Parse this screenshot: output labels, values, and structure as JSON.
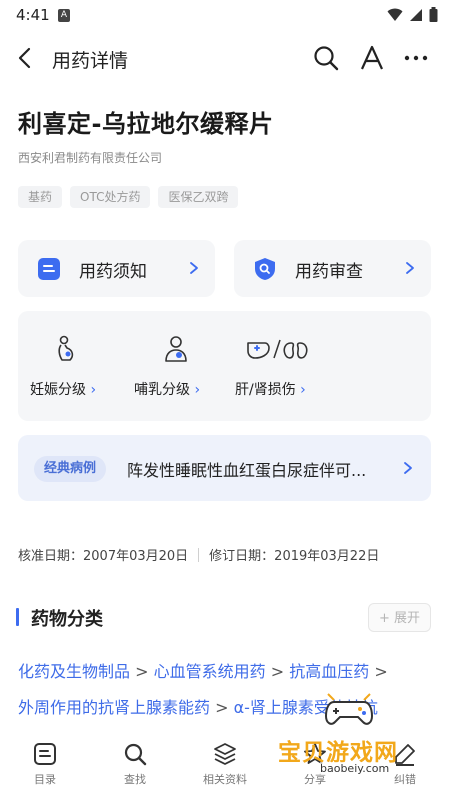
{
  "status_bar": {
    "time": "4:41",
    "badge": "A"
  },
  "header": {
    "title": "用药详情"
  },
  "drug": {
    "name": "利喜定-乌拉地尔缓释片",
    "company": "西安利君制药有限责任公司",
    "tags": [
      "基药",
      "OTC处方药",
      "医保乙双跨"
    ]
  },
  "quick_actions": [
    {
      "label": "用药须知",
      "icon": "document-icon"
    },
    {
      "label": "用药审查",
      "icon": "shield-search-icon"
    }
  ],
  "special_groups": [
    {
      "label": "妊娠分级",
      "icon": "pregnancy-icon"
    },
    {
      "label": "哺乳分级",
      "icon": "breastfeeding-icon"
    },
    {
      "label": "肝/肾损伤",
      "icon": "liver-kidney-icon"
    }
  ],
  "classic_case": {
    "badge": "经典病例",
    "text": "阵发性睡眠性血红蛋白尿症伴可..."
  },
  "dates": {
    "approval": "核准日期：2007年03月20日",
    "revision": "修订日期：2019年03月22日"
  },
  "classification": {
    "title": "药物分类",
    "expand_label": "+ 展开",
    "path": [
      "化药及生物制品",
      "心血管系统用药",
      "抗高血压药",
      "外周作用的抗肾上腺素能药",
      "α-肾上腺素受体拮抗"
    ],
    "separator": ">"
  },
  "bottom_nav": [
    {
      "label": "目录",
      "icon": "catalog-icon"
    },
    {
      "label": "查找",
      "icon": "search-icon"
    },
    {
      "label": "相关资料",
      "icon": "layers-icon"
    },
    {
      "label": "分享",
      "icon": "share-icon"
    },
    {
      "label": "纠错",
      "icon": "edit-icon"
    }
  ],
  "watermark": {
    "text": "宝贝游戏网",
    "url": "baobeiy.com"
  },
  "colors": {
    "accent": "#3d6cf0",
    "link": "#3f6ce8",
    "card_bg": "#f5f6f8",
    "case_bg": "#eef2fb"
  }
}
